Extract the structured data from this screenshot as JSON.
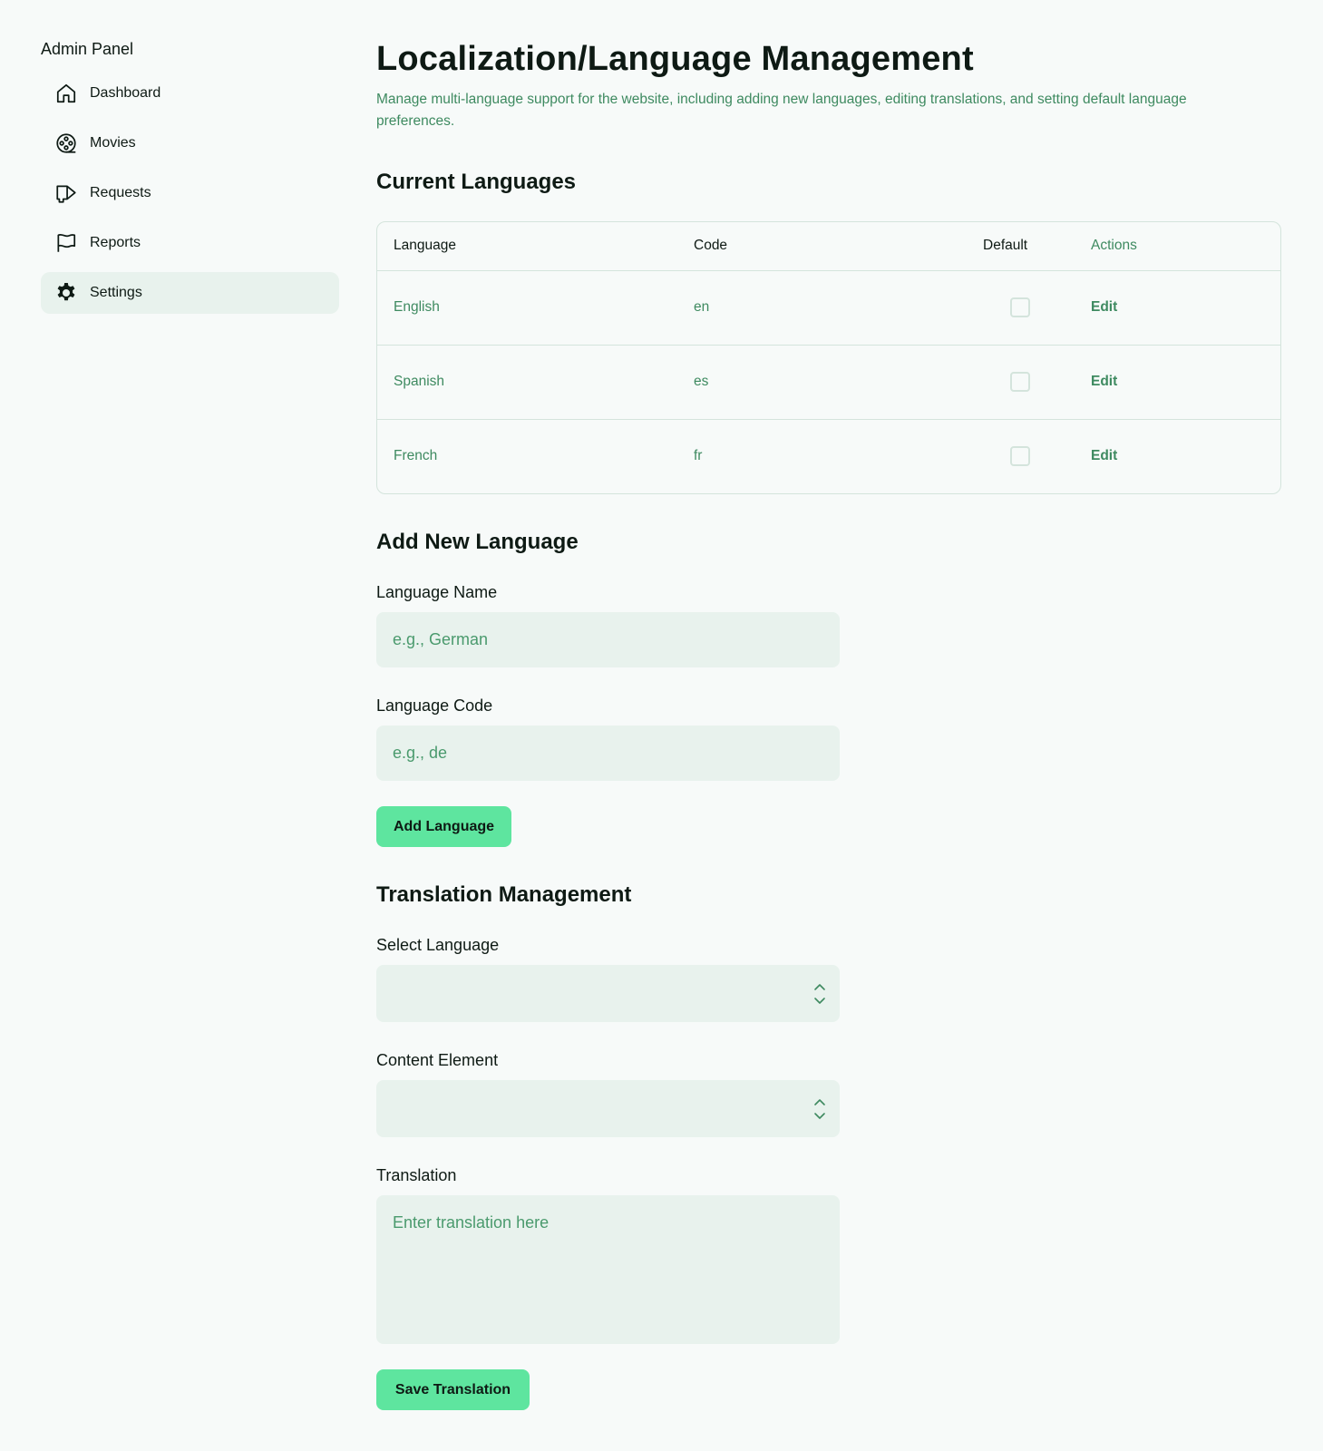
{
  "sidebar": {
    "title": "Admin Panel",
    "items": [
      {
        "label": "Dashboard",
        "icon": "home-icon"
      },
      {
        "label": "Movies",
        "icon": "film-reel-icon"
      },
      {
        "label": "Requests",
        "icon": "megaphone-icon"
      },
      {
        "label": "Reports",
        "icon": "flag-icon"
      },
      {
        "label": "Settings",
        "icon": "gear-icon",
        "active": true
      }
    ]
  },
  "header": {
    "title": "Localization/Language Management",
    "description": "Manage multi-language support for the website, including adding new languages, editing translations, and setting default language preferences."
  },
  "current_languages": {
    "title": "Current Languages",
    "columns": [
      "Language",
      "Code",
      "Default",
      "Actions"
    ],
    "rows": [
      {
        "language": "English",
        "code": "en",
        "default": false,
        "action": "Edit"
      },
      {
        "language": "Spanish",
        "code": "es",
        "default": false,
        "action": "Edit"
      },
      {
        "language": "French",
        "code": "fr",
        "default": false,
        "action": "Edit"
      }
    ]
  },
  "add_language": {
    "title": "Add New Language",
    "name_label": "Language Name",
    "name_placeholder": "e.g., German",
    "code_label": "Language Code",
    "code_placeholder": "e.g., de",
    "button_label": "Add Language"
  },
  "translation": {
    "title": "Translation Management",
    "select_language_label": "Select Language",
    "select_language_value": "",
    "content_element_label": "Content Element",
    "content_element_value": "",
    "translation_label": "Translation",
    "translation_placeholder": "Enter translation here",
    "button_label": "Save Translation"
  },
  "colors": {
    "background": "#f7faf9",
    "accent": "#5ee59f",
    "muted_green_text": "#3e8a60",
    "input_bg": "#e8f2ed",
    "border": "#d4e4dc"
  }
}
